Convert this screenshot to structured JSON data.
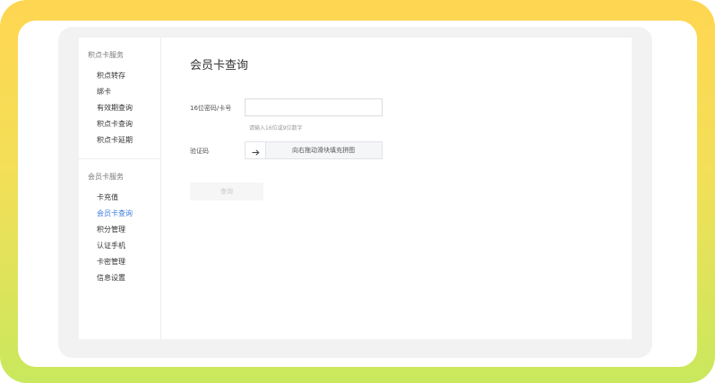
{
  "sidebar": {
    "groups": [
      {
        "heading": "积点卡服务",
        "items": [
          "积点转存",
          "绑卡",
          "有效期查询",
          "积点卡查询",
          "积点卡延期"
        ]
      },
      {
        "heading": "会员卡服务",
        "items": [
          "卡充值",
          "会员卡查询",
          "积分管理",
          "认证手机",
          "卡密管理",
          "信息设置"
        ],
        "active_index": 1
      }
    ]
  },
  "main": {
    "title": "会员卡查询",
    "card_field": {
      "label": "16位密码/卡号",
      "value": "",
      "hint": "请输入16位或9位数字"
    },
    "captcha": {
      "label": "验证码",
      "handle_icon": "arrow-right-icon",
      "slider_text": "向右拖动滑块填充拼图"
    },
    "query_button": "查询"
  },
  "colors": {
    "frame_top": "#ffd652",
    "frame_bottom": "#c9e85d",
    "active_link": "#3b7de0"
  }
}
